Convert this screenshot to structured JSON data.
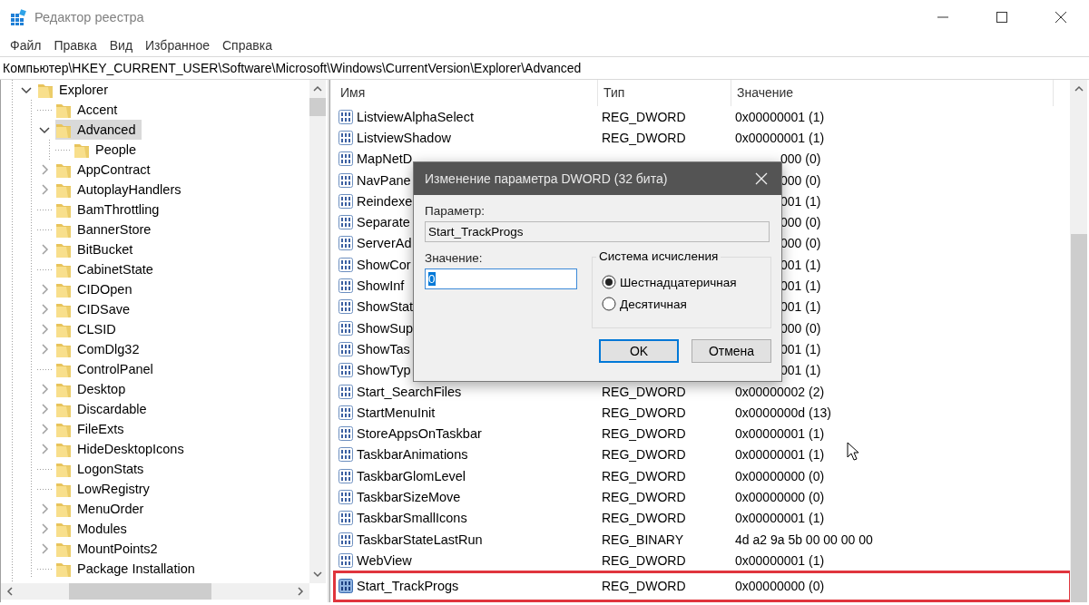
{
  "window": {
    "title": "Редактор реестра"
  },
  "menu": [
    "Файл",
    "Правка",
    "Вид",
    "Избранное",
    "Справка"
  ],
  "address": "Компьютер\\HKEY_CURRENT_USER\\Software\\Microsoft\\Windows\\CurrentVersion\\Explorer\\Advanced",
  "tree": [
    {
      "label": "Explorer",
      "has_children": true,
      "expanded": true,
      "selected": false,
      "children": [
        {
          "label": "Accent",
          "has_children": false,
          "selected": false
        },
        {
          "label": "Advanced",
          "has_children": true,
          "expanded": true,
          "selected": true,
          "children": [
            {
              "label": "People",
              "has_children": false,
              "selected": false
            }
          ]
        },
        {
          "label": "AppContract",
          "has_children": true,
          "expanded": false,
          "selected": false
        },
        {
          "label": "AutoplayHandlers",
          "has_children": true,
          "expanded": false,
          "selected": false
        },
        {
          "label": "BamThrottling",
          "has_children": false,
          "selected": false
        },
        {
          "label": "BannerStore",
          "has_children": false,
          "selected": false
        },
        {
          "label": "BitBucket",
          "has_children": true,
          "expanded": false,
          "selected": false
        },
        {
          "label": "CabinetState",
          "has_children": false,
          "selected": false
        },
        {
          "label": "CIDOpen",
          "has_children": true,
          "expanded": false,
          "selected": false
        },
        {
          "label": "CIDSave",
          "has_children": true,
          "expanded": false,
          "selected": false
        },
        {
          "label": "CLSID",
          "has_children": true,
          "expanded": false,
          "selected": false
        },
        {
          "label": "ComDlg32",
          "has_children": true,
          "expanded": false,
          "selected": false
        },
        {
          "label": "ControlPanel",
          "has_children": false,
          "selected": false
        },
        {
          "label": "Desktop",
          "has_children": true,
          "expanded": false,
          "selected": false
        },
        {
          "label": "Discardable",
          "has_children": true,
          "expanded": false,
          "selected": false
        },
        {
          "label": "FileExts",
          "has_children": true,
          "expanded": false,
          "selected": false
        },
        {
          "label": "HideDesktopIcons",
          "has_children": true,
          "expanded": false,
          "selected": false
        },
        {
          "label": "LogonStats",
          "has_children": false,
          "selected": false
        },
        {
          "label": "LowRegistry",
          "has_children": false,
          "selected": false
        },
        {
          "label": "MenuOrder",
          "has_children": true,
          "expanded": false,
          "selected": false
        },
        {
          "label": "Modules",
          "has_children": true,
          "expanded": false,
          "selected": false
        },
        {
          "label": "MountPoints2",
          "has_children": true,
          "expanded": false,
          "selected": false
        },
        {
          "label": "Package Installation",
          "has_children": false,
          "selected": false
        }
      ]
    }
  ],
  "list": {
    "columns": [
      "Имя",
      "Тип",
      "Значение"
    ],
    "rows": [
      {
        "kind": "full",
        "name": "ListviewAlphaSelect",
        "type": "REG_DWORD",
        "value": "0x00000001 (1)",
        "selected": false,
        "highlighted": false
      },
      {
        "kind": "full",
        "name": "ListviewShadow",
        "type": "REG_DWORD",
        "value": "0x00000001 (1)",
        "selected": false,
        "highlighted": false
      },
      {
        "kind": "covered",
        "name": "MapNetD",
        "value": "000 (0)",
        "selected": false,
        "highlighted": false
      },
      {
        "kind": "covered",
        "name": "NavPane",
        "value": "000 (0)",
        "selected": false,
        "highlighted": false
      },
      {
        "kind": "covered",
        "name": "Reindexe",
        "value": "001 (1)",
        "selected": false,
        "highlighted": false
      },
      {
        "kind": "covered",
        "name": "Separate",
        "value": "000 (0)",
        "selected": false,
        "highlighted": false
      },
      {
        "kind": "covered",
        "name": "ServerAd",
        "value": "000 (0)",
        "selected": false,
        "highlighted": false
      },
      {
        "kind": "covered",
        "name": "ShowCor",
        "value": "001 (1)",
        "selected": false,
        "highlighted": false
      },
      {
        "kind": "covered",
        "name": "ShowInf",
        "value": "001 (1)",
        "selected": false,
        "highlighted": false
      },
      {
        "kind": "covered",
        "name": "ShowStat",
        "value": "001 (1)",
        "selected": false,
        "highlighted": false
      },
      {
        "kind": "covered",
        "name": "ShowSup",
        "value": "000 (0)",
        "selected": false,
        "highlighted": false
      },
      {
        "kind": "covered",
        "name": "ShowTas",
        "value": "001 (1)",
        "selected": false,
        "highlighted": false
      },
      {
        "kind": "covered",
        "name": "ShowTyp",
        "value": "001 (1)",
        "selected": false,
        "highlighted": false
      },
      {
        "kind": "full",
        "name": "Start_SearchFiles",
        "type": "REG_DWORD",
        "value": "0x00000002 (2)",
        "selected": false,
        "highlighted": false
      },
      {
        "kind": "full",
        "name": "StartMenuInit",
        "type": "REG_DWORD",
        "value": "0x0000000d (13)",
        "selected": false,
        "highlighted": false
      },
      {
        "kind": "full",
        "name": "StoreAppsOnTaskbar",
        "type": "REG_DWORD",
        "value": "0x00000001 (1)",
        "selected": false,
        "highlighted": false
      },
      {
        "kind": "full",
        "name": "TaskbarAnimations",
        "type": "REG_DWORD",
        "value": "0x00000001 (1)",
        "selected": false,
        "highlighted": false
      },
      {
        "kind": "full",
        "name": "TaskbarGlomLevel",
        "type": "REG_DWORD",
        "value": "0x00000000 (0)",
        "selected": false,
        "highlighted": false
      },
      {
        "kind": "full",
        "name": "TaskbarSizeMove",
        "type": "REG_DWORD",
        "value": "0x00000000 (0)",
        "selected": false,
        "highlighted": false
      },
      {
        "kind": "full",
        "name": "TaskbarSmallIcons",
        "type": "REG_DWORD",
        "value": "0x00000001 (1)",
        "selected": false,
        "highlighted": false
      },
      {
        "kind": "full",
        "name": "TaskbarStateLastRun",
        "type": "REG_BINARY",
        "value": "4d a2 9a 5b 00 00 00 00",
        "selected": false,
        "highlighted": false
      },
      {
        "kind": "full",
        "name": "WebView",
        "type": "REG_DWORD",
        "value": "0x00000001 (1)",
        "selected": false,
        "highlighted": false
      },
      {
        "kind": "full",
        "name": "Start_TrackProgs",
        "type": "REG_DWORD",
        "value": "0x00000000 (0)",
        "selected": true,
        "highlighted": true
      }
    ]
  },
  "dialog": {
    "title": "Изменение параметра DWORD (32 бита)",
    "name_label": "Параметр:",
    "name_value": "Start_TrackProgs",
    "value_label": "Значение:",
    "value": "0",
    "value_text_selected": true,
    "base_group": "Система исчисления",
    "bases": [
      {
        "label": "Шестнадцатеричная",
        "selected": true
      },
      {
        "label": "Десятичная",
        "selected": false
      }
    ],
    "buttons": [
      {
        "label": "OK",
        "default": true
      },
      {
        "label": "Отмена",
        "default": false
      }
    ]
  }
}
